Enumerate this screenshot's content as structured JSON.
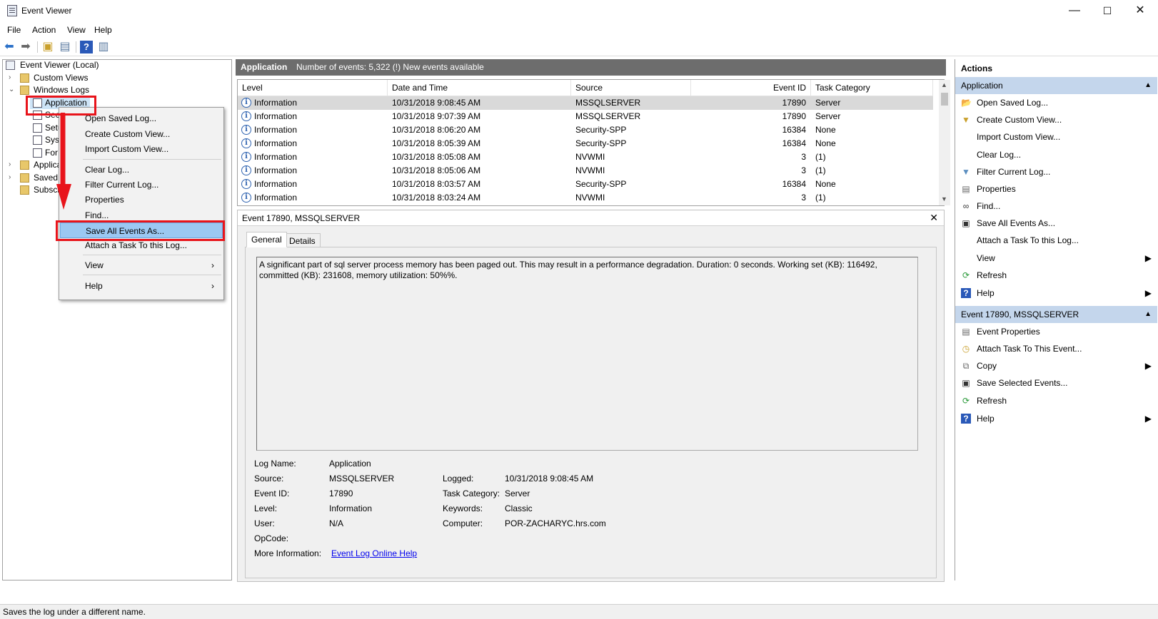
{
  "window": {
    "title": "Event Viewer",
    "minimize": "—",
    "maximize": "☐",
    "close": "✕"
  },
  "menu": [
    "File",
    "Action",
    "View",
    "Help"
  ],
  "tree": {
    "root": "Event Viewer (Local)",
    "custom_views": "Custom Views",
    "windows_logs": "Windows Logs",
    "application": "Application",
    "security": "Secu",
    "setup": "Setu",
    "system": "Syst",
    "forwarded": "For",
    "apps_services": "Applica",
    "saved_logs": "Saved L",
    "subscriptions": "Subscri"
  },
  "context_menu": {
    "open_saved_log": "Open Saved Log...",
    "create_custom_view": "Create Custom View...",
    "import_custom_view": "Import Custom View...",
    "clear_log": "Clear Log...",
    "filter_current_log": "Filter Current Log...",
    "properties": "Properties",
    "find": "Find...",
    "save_all_events": "Save All Events As...",
    "attach_task": "Attach a Task To this Log...",
    "view": "View",
    "help": "Help",
    "submenu_arrow": "›"
  },
  "center": {
    "log_name": "Application",
    "event_count": "Number of events: 5,322 (!) New events available"
  },
  "grid": {
    "headers": {
      "level": "Level",
      "datetime": "Date and Time",
      "source": "Source",
      "event_id": "Event ID",
      "task_category": "Task Category"
    },
    "rows": [
      {
        "level": "Information",
        "datetime": "10/31/2018 9:08:45 AM",
        "source": "MSSQLSERVER",
        "event_id": "17890",
        "task": "Server"
      },
      {
        "level": "Information",
        "datetime": "10/31/2018 9:07:39 AM",
        "source": "MSSQLSERVER",
        "event_id": "17890",
        "task": "Server"
      },
      {
        "level": "Information",
        "datetime": "10/31/2018 8:06:20 AM",
        "source": "Security-SPP",
        "event_id": "16384",
        "task": "None"
      },
      {
        "level": "Information",
        "datetime": "10/31/2018 8:05:39 AM",
        "source": "Security-SPP",
        "event_id": "16384",
        "task": "None"
      },
      {
        "level": "Information",
        "datetime": "10/31/2018 8:05:08 AM",
        "source": "NVWMI",
        "event_id": "3",
        "task": "(1)"
      },
      {
        "level": "Information",
        "datetime": "10/31/2018 8:05:06 AM",
        "source": "NVWMI",
        "event_id": "3",
        "task": "(1)"
      },
      {
        "level": "Information",
        "datetime": "10/31/2018 8:03:57 AM",
        "source": "Security-SPP",
        "event_id": "16384",
        "task": "None"
      },
      {
        "level": "Information",
        "datetime": "10/31/2018 8:03:24 AM",
        "source": "NVWMI",
        "event_id": "3",
        "task": "(1)"
      }
    ]
  },
  "detail": {
    "title": "Event 17890, MSSQLSERVER",
    "tab_general": "General",
    "tab_details": "Details",
    "description": "A significant part of sql server process memory has been paged out. This may result in a performance degradation. Duration: 0 seconds. Working set (KB): 116492, committed (KB): 231608, memory utilization: 50%%.",
    "labels": {
      "log_name": "Log Name:",
      "source": "Source:",
      "event_id": "Event ID:",
      "level": "Level:",
      "user": "User:",
      "opcode": "OpCode:",
      "more_info": "More Information:",
      "logged": "Logged:",
      "task_category": "Task Category:",
      "keywords": "Keywords:",
      "computer": "Computer:"
    },
    "values": {
      "log_name": "Application",
      "source": "MSSQLSERVER",
      "event_id": "17890",
      "level": "Information",
      "user": "N/A",
      "opcode": "",
      "more_info": "Event Log Online Help",
      "logged": "10/31/2018 9:08:45 AM",
      "task_category": "Server",
      "keywords": "Classic",
      "computer": "POR-ZACHARYC.hrs.com"
    }
  },
  "actions": {
    "title": "Actions",
    "section1": "Application",
    "items1": [
      "Open Saved Log...",
      "Create Custom View...",
      "Import Custom View...",
      "Clear Log...",
      "Filter Current Log...",
      "Properties",
      "Find...",
      "Save All Events As...",
      "Attach a Task To this Log...",
      "View",
      "Refresh",
      "Help"
    ],
    "section2": "Event 17890, MSSQLSERVER",
    "items2": [
      "Event Properties",
      "Attach Task To This Event...",
      "Copy",
      "Save Selected Events...",
      "Refresh",
      "Help"
    ]
  },
  "status": "Saves the log under a different name.",
  "colors": {
    "highlight_red": "#e8141b",
    "menu_highlight": "#9bc8f2",
    "action_section": "#c4d6ec",
    "center_header": "#6d6d6d"
  }
}
